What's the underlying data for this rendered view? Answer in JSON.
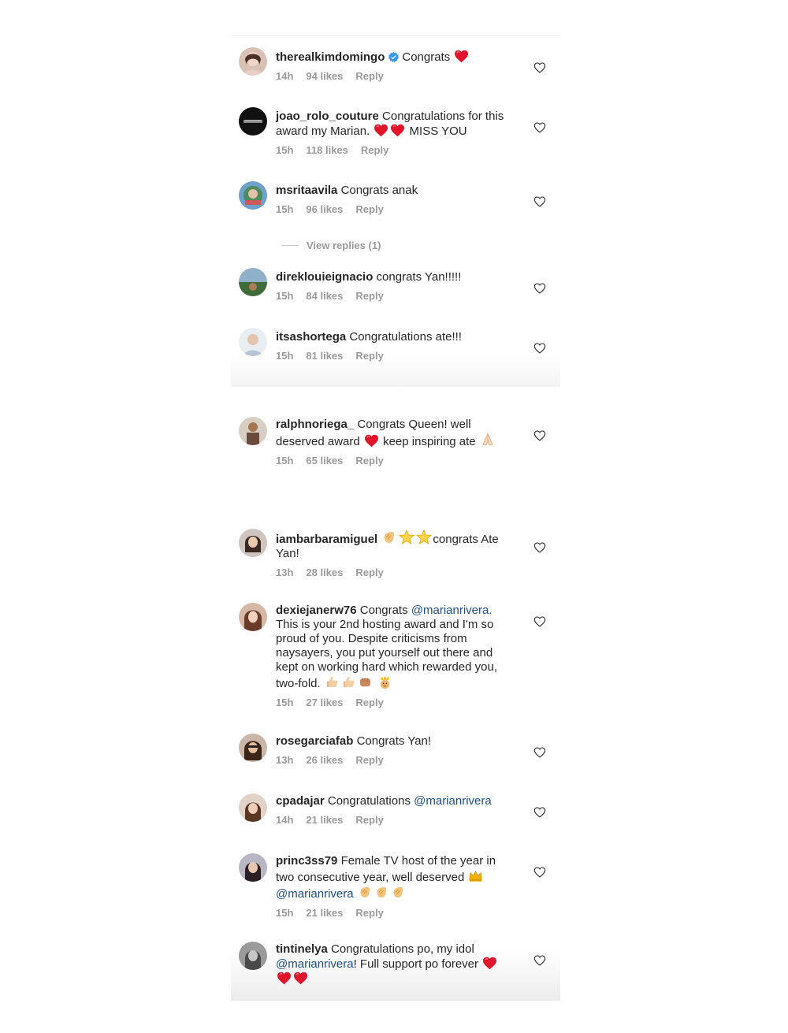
{
  "accent": {
    "text": "#262626",
    "meta": "#9a9a9a",
    "mention": "#1f4e8c",
    "heart_red": "#e0142b",
    "verified": "#3897f0"
  },
  "panel1": {
    "comments": [
      {
        "username": "therealkimdomingo",
        "text": "Congrats",
        "time": "14h",
        "likes": "94 likes",
        "reply": "Reply"
      },
      {
        "username": "joao_rolo_couture",
        "text": "Congratulations for this award my Marian.",
        "text2": "MISS YOU",
        "time": "15h",
        "likes": "118 likes",
        "reply": "Reply"
      },
      {
        "username": "msritaavila",
        "text": "Congrats anak",
        "time": "15h",
        "likes": "96 likes",
        "reply": "Reply"
      },
      {
        "username": "direklouieignacio",
        "text": "congrats Yan!!!!!",
        "time": "15h",
        "likes": "84 likes",
        "reply": "Reply"
      },
      {
        "username": "itsashortega",
        "text": "Congratulations ate!!!",
        "time": "15h",
        "likes": "81 likes",
        "reply": "Reply"
      }
    ],
    "view_replies": "View replies (1)"
  },
  "panel2": {
    "comments": [
      {
        "username": "ralphnoriega_",
        "text": "Congrats Queen! well deserved award",
        "text2": "keep inspiring ate",
        "time": "15h",
        "likes": "65 likes",
        "reply": "Reply"
      },
      {
        "username": "iambarbaramiguel",
        "text": "congrats Ate Yan!",
        "time": "13h",
        "likes": "28 likes",
        "reply": "Reply"
      },
      {
        "username": "dexiejanerw76",
        "text": "Congrats",
        "mention": "@marianrivera.",
        "text2": "This is your 2nd hosting award and I'm so proud of you. Despite criticisms from naysayers, you put yourself out there and kept on working hard which rewarded you, two-fold.",
        "time": "15h",
        "likes": "27 likes",
        "reply": "Reply"
      },
      {
        "username": "rosegarciafab",
        "text": "Congrats Yan!",
        "time": "13h",
        "likes": "26 likes",
        "reply": "Reply"
      },
      {
        "username": "cpadajar",
        "text": "Congratulations",
        "mention": "@marianrivera",
        "time": "14h",
        "likes": "21 likes",
        "reply": "Reply"
      },
      {
        "username": "princ3ss79",
        "text": "Female TV host of the year in two consecutive year, well deserved",
        "mention": "@marianrivera",
        "time": "15h",
        "likes": "21 likes",
        "reply": "Reply"
      },
      {
        "username": "tintinelya",
        "text": "Congratulations po, my idol",
        "mention": "@marianrivera",
        "text2": "! Full support po forever"
      }
    ]
  }
}
